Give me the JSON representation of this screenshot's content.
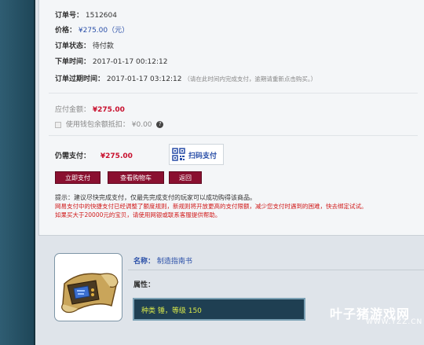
{
  "order": {
    "number_label": "订单号：",
    "number_value": "1512604",
    "price_label": "价格：",
    "price_value": "¥275.00（元）",
    "status_label": "订单状态：",
    "status_value": "待付款",
    "order_time_label": "下单时间：",
    "order_time_value": "2017-01-17 00:12:12",
    "expire_label": "订单过期时间：",
    "expire_value": "2017-01-17 03:12:12",
    "expire_note": "（请在此时间内完成支付，逾期请重新点击购买。）"
  },
  "payment": {
    "due_label": "应付金额：",
    "due_value": "¥275.00",
    "wallet_label": "使用钱包余额抵扣：",
    "wallet_value": "¥0.00",
    "help_glyph": "?",
    "still_label": "仍需支付：",
    "still_value": "¥275.00",
    "qr_label": "扫码支付"
  },
  "buttons": {
    "pay_now": "立即支付",
    "view_cart": "查看购物车",
    "back": "返回"
  },
  "tips": {
    "line1": "提示：建议尽快完成支付，仅最先完成支付的玩家可以成功购得该商品。",
    "line2": "网易支付中的快捷支付已经调整了额度规则，新规则将开放更高的支付限额，减少您支付时遇到的困难，快去绑定试试。",
    "line3": "如果买大于20000元的宝贝，请使用网银或联系客服提供帮助。"
  },
  "item": {
    "name_label": "名称：",
    "name_value": "制造指南书",
    "attr_label": "属性：",
    "attr_value": "种类 锤，等级 150"
  },
  "watermark": {
    "main": "叶子猪游戏网",
    "sub": "WWW.YZZ.CN"
  }
}
